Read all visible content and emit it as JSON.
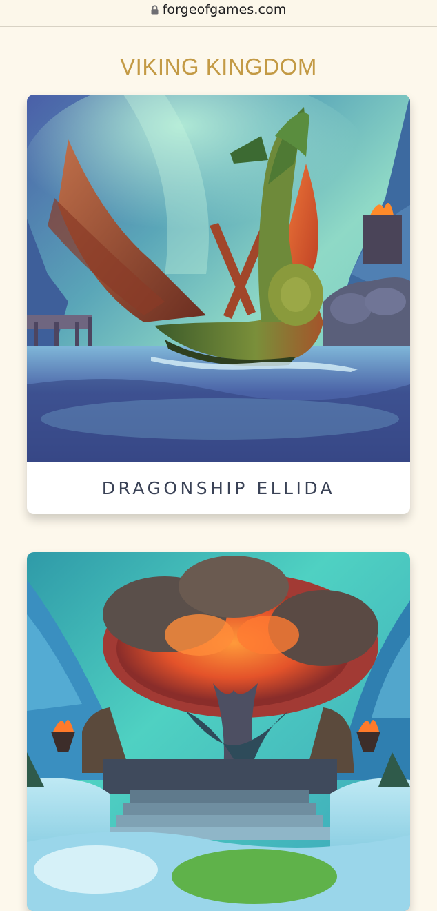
{
  "browser": {
    "url": "forgeofgames.com",
    "lock_icon": "lock-icon"
  },
  "page": {
    "title": "VIKING KINGDOM",
    "title_color": "#c39a45",
    "background": "#fdf8ec"
  },
  "cards": [
    {
      "caption": "DRAGONSHIP ELLIDA",
      "image": "dragonship-illustration"
    },
    {
      "caption": "",
      "image": "great-tree-illustration"
    }
  ]
}
